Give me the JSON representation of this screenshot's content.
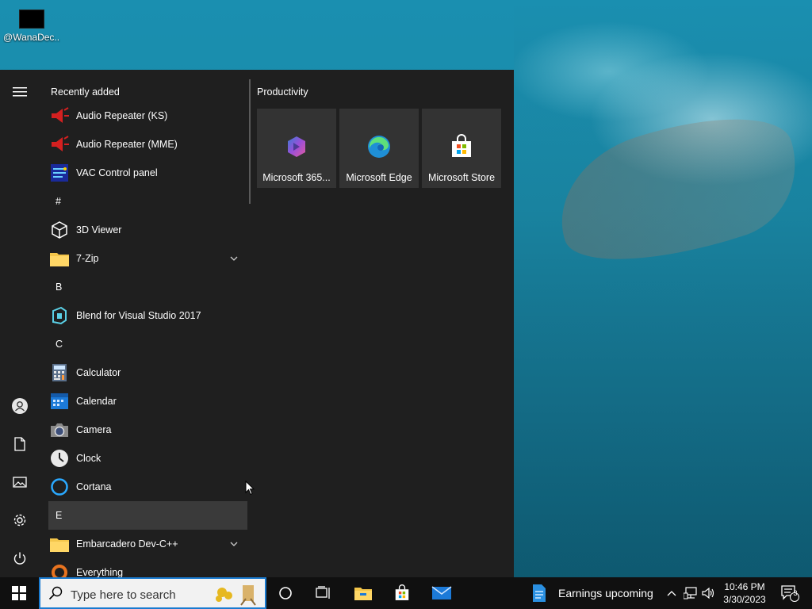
{
  "desktop": {
    "icon_label": "@WanaDec..."
  },
  "start_menu": {
    "recently_added_label": "Recently added",
    "apps": [
      {
        "type": "group",
        "label": "Recently added"
      },
      {
        "type": "app",
        "label": "Audio Repeater (KS)",
        "icon": "speaker-red-icon"
      },
      {
        "type": "app",
        "label": "Audio Repeater (MME)",
        "icon": "speaker-red-icon"
      },
      {
        "type": "app",
        "label": "VAC Control panel",
        "icon": "vac-icon"
      },
      {
        "type": "letter",
        "label": "#"
      },
      {
        "type": "app",
        "label": "3D Viewer",
        "icon": "cube-icon"
      },
      {
        "type": "app",
        "label": "7-Zip",
        "icon": "folder-icon",
        "expandable": true
      },
      {
        "type": "letter",
        "label": "B"
      },
      {
        "type": "app",
        "label": "Blend for Visual Studio 2017",
        "icon": "blend-icon"
      },
      {
        "type": "letter",
        "label": "C"
      },
      {
        "type": "app",
        "label": "Calculator",
        "icon": "calculator-icon"
      },
      {
        "type": "app",
        "label": "Calendar",
        "icon": "calendar-icon"
      },
      {
        "type": "app",
        "label": "Camera",
        "icon": "camera-icon"
      },
      {
        "type": "app",
        "label": "Clock",
        "icon": "clock-icon"
      },
      {
        "type": "app",
        "label": "Cortana",
        "icon": "cortana-icon"
      },
      {
        "type": "letter",
        "label": "E",
        "hover": true
      },
      {
        "type": "app",
        "label": "Embarcadero Dev-C++",
        "icon": "folder-icon",
        "expandable": true
      },
      {
        "type": "app",
        "label": "Everything",
        "icon": "everything-icon"
      }
    ],
    "tiles_group": "Productivity",
    "tiles": [
      {
        "label": "Microsoft 365...",
        "icon": "microsoft-365-icon"
      },
      {
        "label": "Microsoft Edge",
        "icon": "edge-icon"
      },
      {
        "label": "Microsoft Store",
        "icon": "store-icon"
      }
    ]
  },
  "taskbar": {
    "search_placeholder": "Type here to search",
    "news_label": "Earnings upcoming",
    "time": "10:46 PM",
    "date": "3/30/2023",
    "notification_count": "3"
  }
}
